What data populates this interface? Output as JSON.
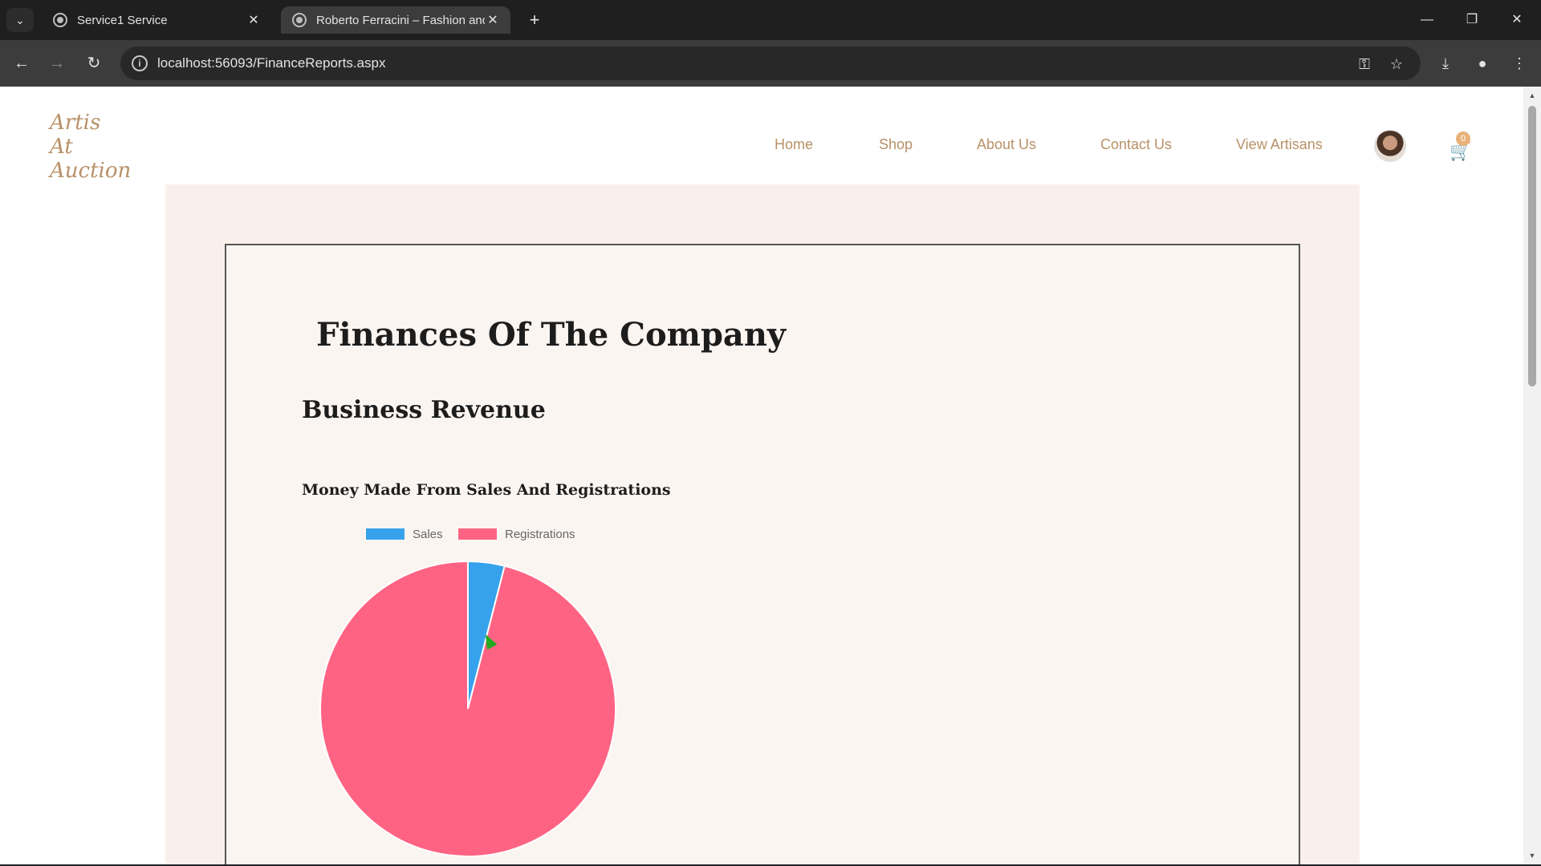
{
  "browser": {
    "tabs": [
      {
        "title": "Service1 Service",
        "active": false
      },
      {
        "title": "Roberto Ferracini – Fashion and",
        "active": true
      }
    ],
    "url": "localhost:56093/FinanceReports.aspx"
  },
  "site": {
    "logo_lines": [
      "Artis",
      "At",
      "Auction"
    ],
    "nav": {
      "home": "Home",
      "shop": "Shop",
      "about": "About Us",
      "contact": "Contact Us",
      "artisans": "View Artisans"
    },
    "cart_count": "0"
  },
  "main": {
    "title": "Finances Of The Company",
    "section": "Business Revenue",
    "chart_title": "Money Made From Sales And Registrations"
  },
  "chart_data": {
    "type": "pie",
    "title": "Money Made From Sales And Registrations",
    "categories": [
      "Sales",
      "Registrations"
    ],
    "values": [
      4,
      96
    ],
    "colors": [
      "#36a2eb",
      "#ff6384"
    ],
    "legend": "top"
  },
  "colors": {
    "accent": "#b89168",
    "page_bg": "#f9f0ec"
  }
}
